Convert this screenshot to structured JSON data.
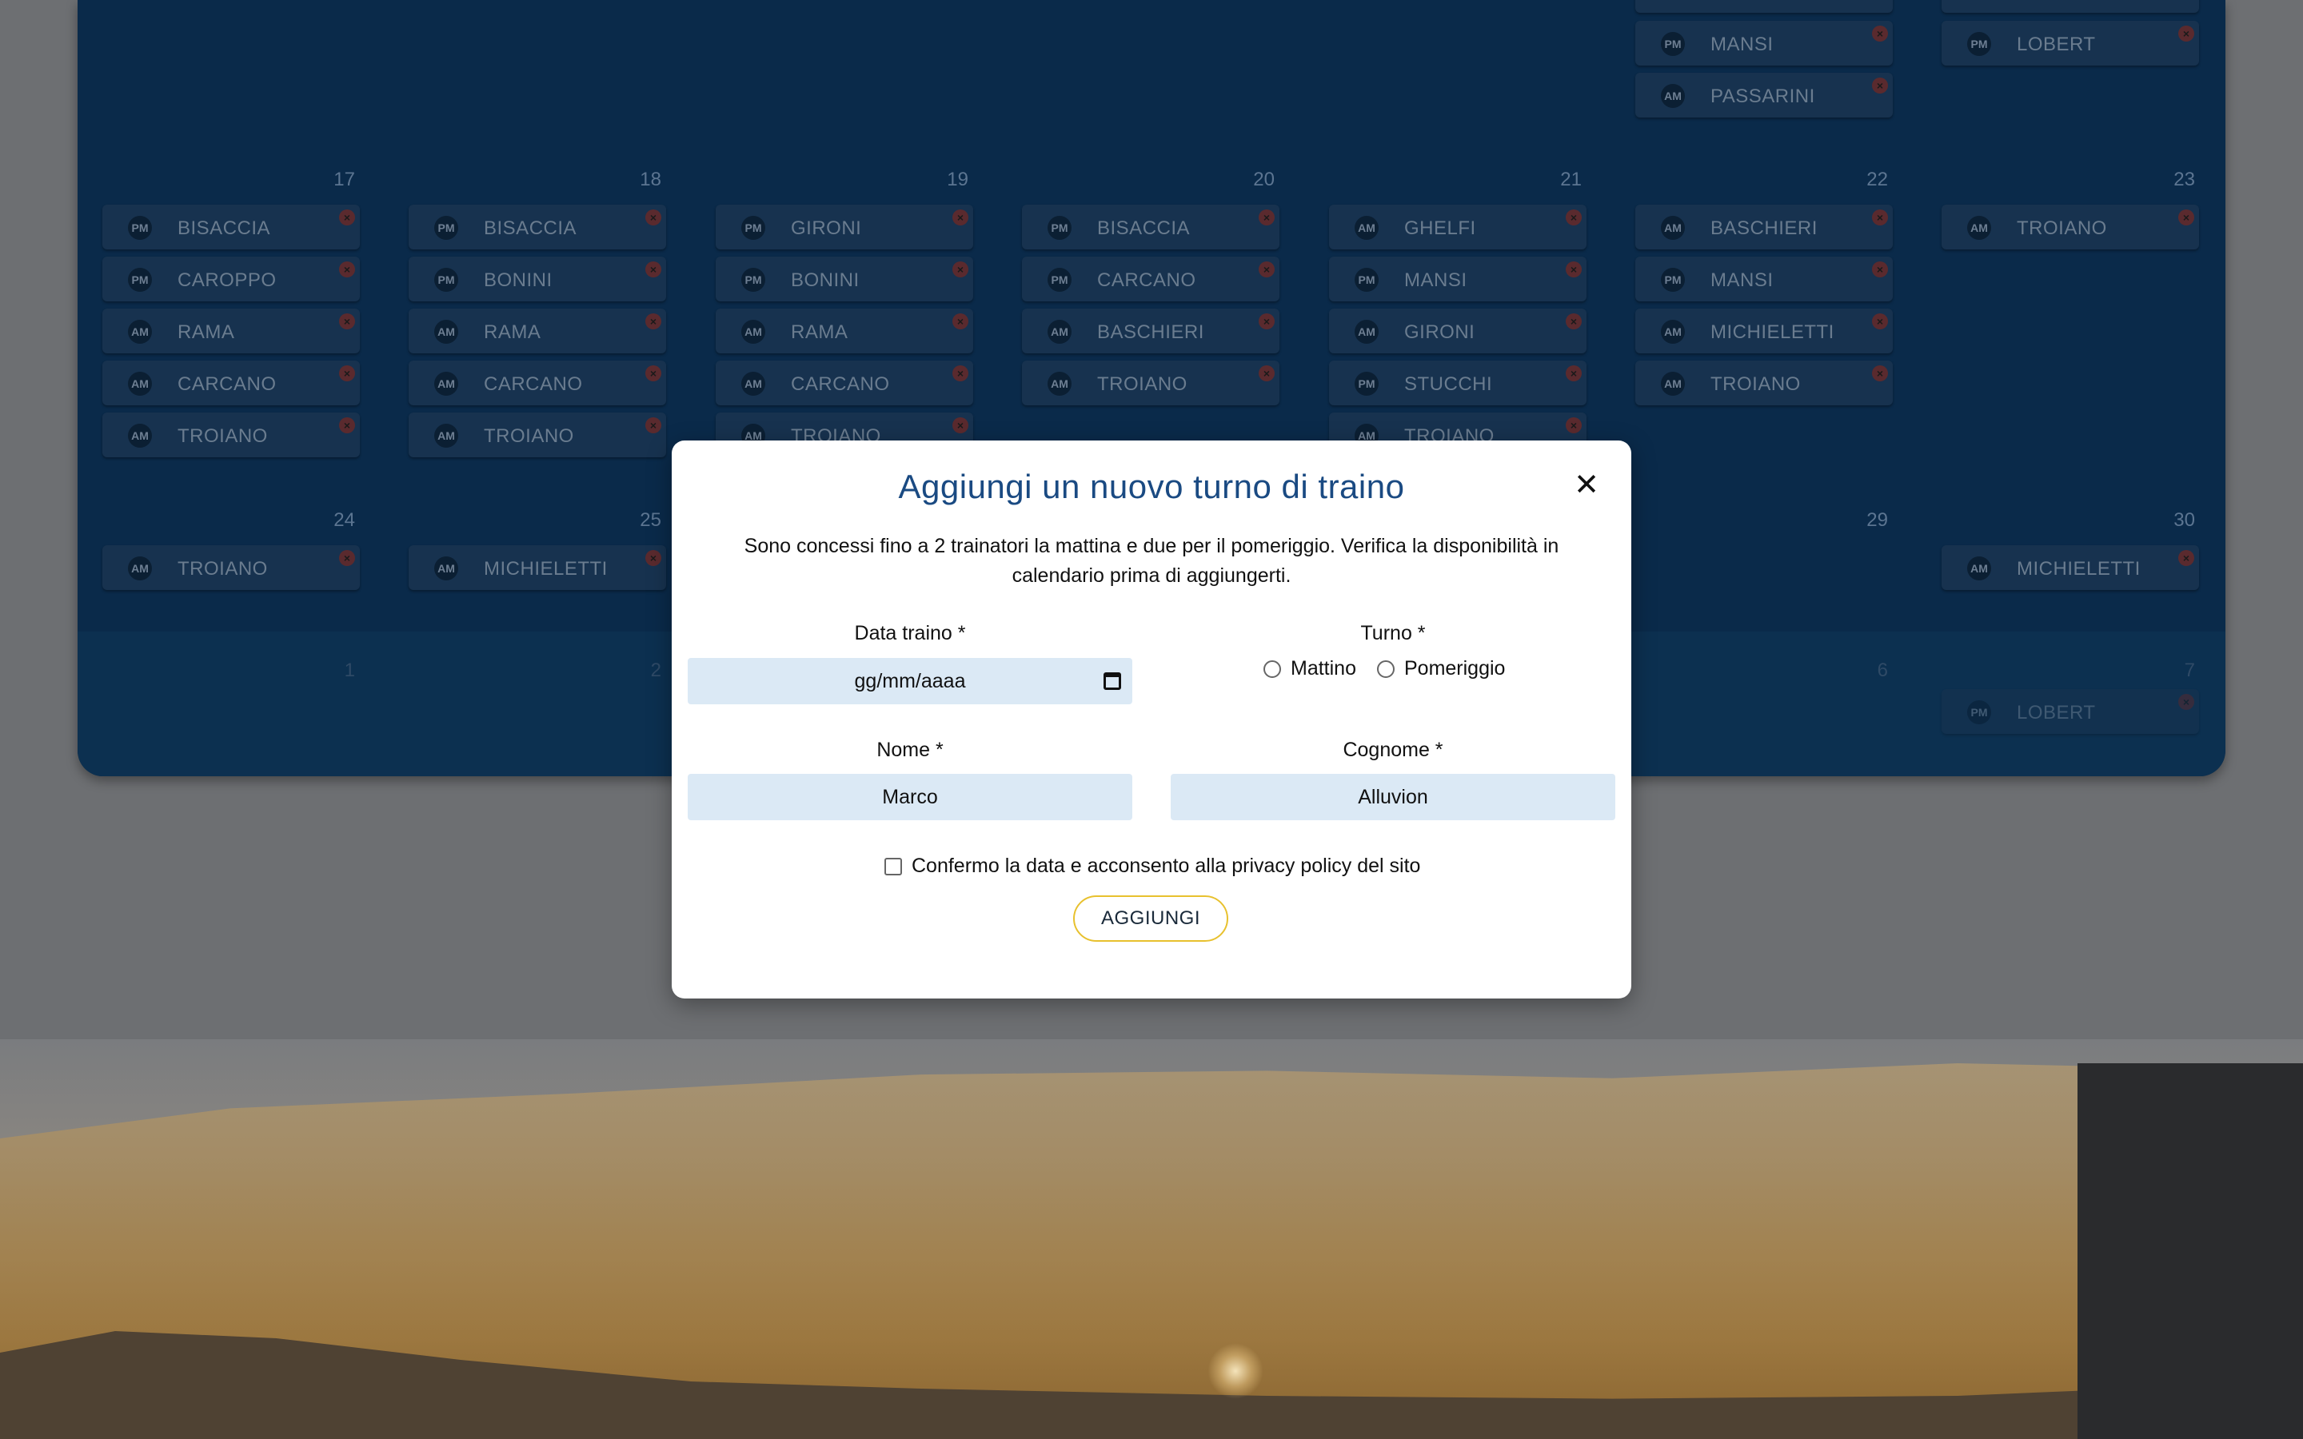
{
  "calendar": {
    "top_row": {
      "chips": [
        {
          "badge": "PM",
          "name": "MANSI"
        },
        {
          "badge": "AM",
          "name": "PASSARINI"
        },
        {
          "badge": "PM",
          "name": "LOBERT"
        }
      ]
    },
    "week1": {
      "days": [
        "17",
        "18",
        "19",
        "20",
        "21",
        "22",
        "23"
      ],
      "columns": [
        [
          {
            "badge": "PM",
            "name": "BISACCIA"
          },
          {
            "badge": "PM",
            "name": "CAROPPO"
          },
          {
            "badge": "AM",
            "name": "RAMA"
          },
          {
            "badge": "AM",
            "name": "CARCANO"
          },
          {
            "badge": "AM",
            "name": "TROIANO"
          }
        ],
        [
          {
            "badge": "PM",
            "name": "BISACCIA"
          },
          {
            "badge": "PM",
            "name": "BONINI"
          },
          {
            "badge": "AM",
            "name": "RAMA"
          },
          {
            "badge": "AM",
            "name": "CARCANO"
          },
          {
            "badge": "AM",
            "name": "TROIANO"
          }
        ],
        [
          {
            "badge": "PM",
            "name": "GIRONI"
          },
          {
            "badge": "PM",
            "name": "BONINI"
          },
          {
            "badge": "AM",
            "name": "RAMA"
          },
          {
            "badge": "AM",
            "name": "CARCANO"
          },
          {
            "badge": "AM",
            "name": "TROIANO"
          }
        ],
        [
          {
            "badge": "PM",
            "name": "BISACCIA"
          },
          {
            "badge": "PM",
            "name": "CARCANO"
          },
          {
            "badge": "AM",
            "name": "BASCHIERI"
          },
          {
            "badge": "AM",
            "name": "TROIANO"
          }
        ],
        [
          {
            "badge": "AM",
            "name": "GHELFI"
          },
          {
            "badge": "PM",
            "name": "MANSI"
          },
          {
            "badge": "AM",
            "name": "GIRONI"
          },
          {
            "badge": "PM",
            "name": "STUCCHI"
          },
          {
            "badge": "AM",
            "name": "TROIANO"
          }
        ],
        [
          {
            "badge": "AM",
            "name": "BASCHIERI"
          },
          {
            "badge": "PM",
            "name": "MANSI"
          },
          {
            "badge": "AM",
            "name": "MICHIELETTI"
          },
          {
            "badge": "AM",
            "name": "TROIANO"
          }
        ],
        [
          {
            "badge": "AM",
            "name": "TROIANO"
          }
        ]
      ]
    },
    "week2": {
      "days": [
        "24",
        "25",
        "29",
        "30"
      ],
      "chips": [
        {
          "badge": "AM",
          "name": "TROIANO"
        },
        {
          "badge": "AM",
          "name": "MICHIELETTI"
        },
        {
          "badge": "AM",
          "name": "MICHIELETTI"
        }
      ]
    },
    "week3": {
      "days": [
        "1",
        "2",
        "6",
        "7"
      ],
      "chips": [
        {
          "badge": "PM",
          "name": "LOBERT"
        }
      ]
    },
    "remove_symbol": "×"
  },
  "modal": {
    "title": "Aggiungi un nuovo turno di traino",
    "close_symbol": "✕",
    "description": "Sono concessi fino a 2 trainatori la mattina e due per il pomeriggio. Verifica la disponibilità in calendario prima di aggiungerti.",
    "date_label": "Data traino *",
    "date_placeholder": "gg/mm/aaaa",
    "shift_label": "Turno *",
    "shift_options": [
      "Mattino",
      "Pomeriggio"
    ],
    "first_name_label": "Nome *",
    "first_name_value": "Marco",
    "last_name_label": "Cognome *",
    "last_name_value": "Alluvion",
    "consent_text": "Confermo la data e acconsento alla privacy policy del sito",
    "submit_label": "AGGIUNGI"
  },
  "colors": {
    "calendar_bg": "#0a2a4a",
    "modal_title": "#1a4a82",
    "input_bg": "#dbe9f5",
    "submit_border": "#e8c12e"
  }
}
